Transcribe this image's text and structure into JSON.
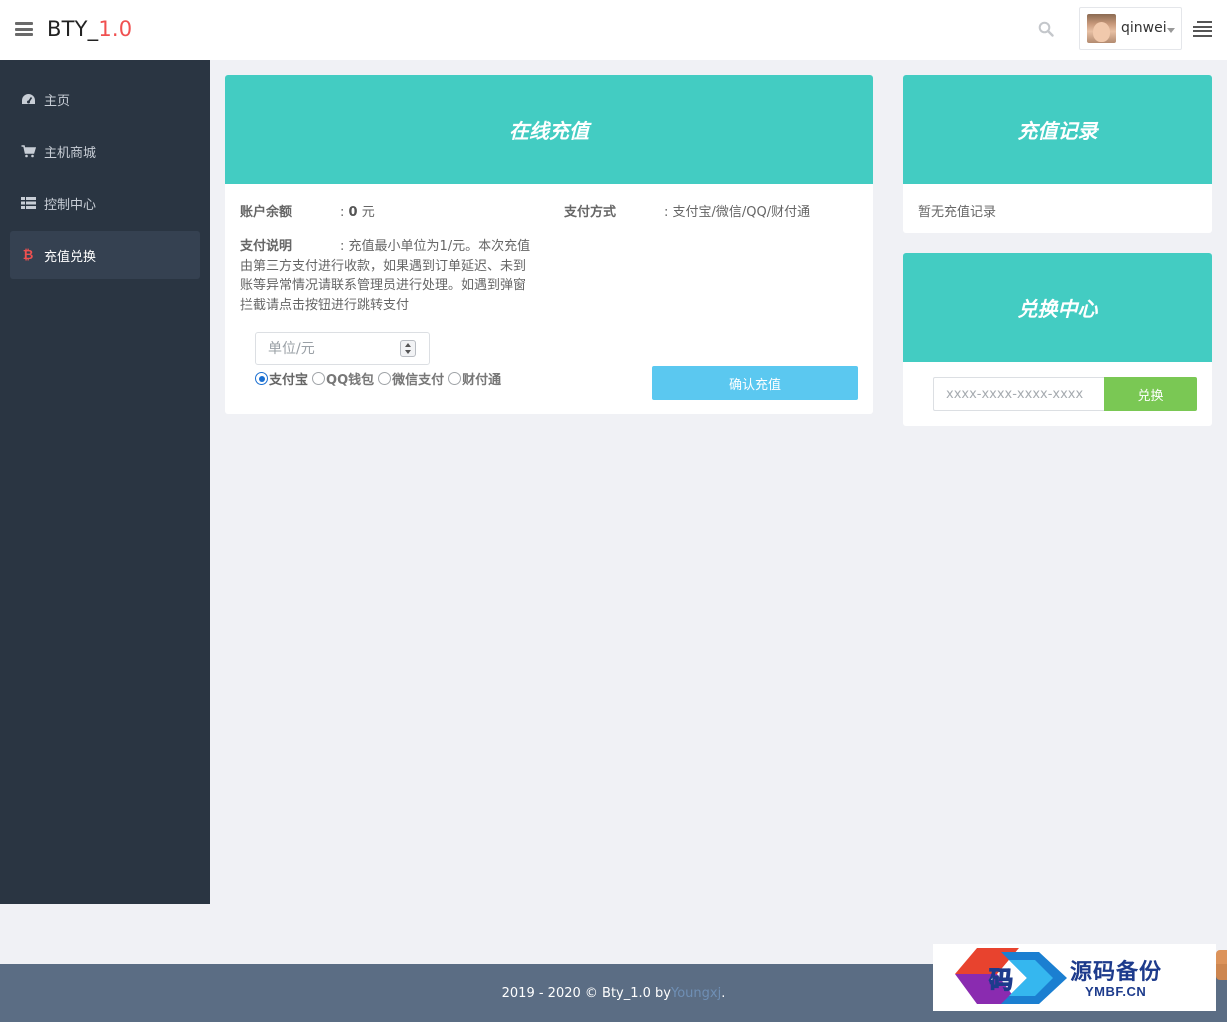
{
  "header": {
    "brand_name": "BTY_",
    "brand_version": "1.0",
    "username": "qinwei"
  },
  "sidebar": {
    "items": [
      {
        "label": "主页",
        "icon": "dashboard-icon"
      },
      {
        "label": "主机商城",
        "icon": "cart-icon"
      },
      {
        "label": "控制中心",
        "icon": "list-icon"
      },
      {
        "label": "充值兑换",
        "icon": "bitcoin-icon",
        "active": true
      }
    ]
  },
  "recharge": {
    "title": "在线充值",
    "balance_label": "账户余额",
    "balance_prefix": ": ",
    "balance_value": "0",
    "balance_unit": " 元",
    "pay_method_label": "支付方式",
    "pay_method_value": ": 支付宝/微信/QQ/财付通",
    "pay_desc_label": "支付说明",
    "pay_desc_text": ": 充值最小单位为1/元。本次充值由第三方支付进行收款，如果遇到订单延迟、未到账等异常情况请联系管理员进行处理。如遇到弹窗拦截请点击按钮进行跳转支付",
    "amount_placeholder": "单位/元",
    "options": [
      "支付宝",
      "QQ钱包",
      "微信支付",
      "财付通"
    ],
    "selected_option": "支付宝",
    "confirm_label": "确认充值"
  },
  "records": {
    "title": "充值记录",
    "empty_text": "暂无充值记录"
  },
  "exchange": {
    "title": "兑换中心",
    "code_placeholder": "xxxx-xxxx-xxxx-xxxx",
    "button_label": "兑换"
  },
  "footer": {
    "text": "2019 - 2020 © Bty_1.0 by ",
    "author": "Youngxj",
    "end": "."
  },
  "watermark": {
    "name": "源码备份",
    "site": "YMBF.CN",
    "logo_char": "码"
  },
  "colors": {
    "accent": "#43ccc2",
    "sidebar": "#2a3542",
    "confirm": "#5bc8f0",
    "exchange": "#7ac854",
    "brand_version": "#f05050"
  }
}
